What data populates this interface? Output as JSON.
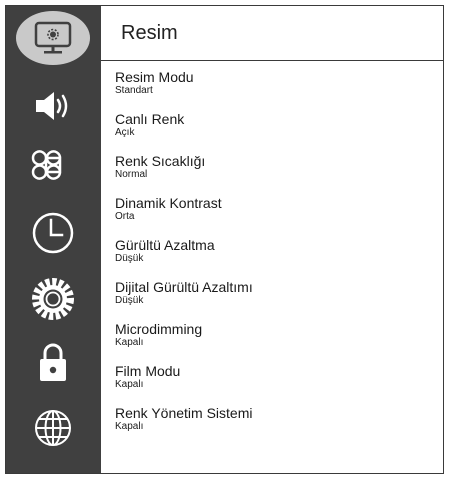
{
  "menu": {
    "title": "Resim",
    "items": [
      {
        "label": "Resim Modu",
        "value": "Standart"
      },
      {
        "label": "Canlı Renk",
        "value": "Açık"
      },
      {
        "label": "Renk Sıcaklığı",
        "value": "Normal"
      },
      {
        "label": "Dinamik Kontrast",
        "value": "Orta"
      },
      {
        "label": "Gürültü Azaltma",
        "value": "Düşük"
      },
      {
        "label": "Dijital Gürültü Azaltımı",
        "value": "Düşük"
      },
      {
        "label": "Microdimming",
        "value": "Kapalı"
      },
      {
        "label": "Film Modu",
        "value": "Kapalı"
      },
      {
        "label": "Renk Yönetim Sistemi",
        "value": "Kapalı"
      }
    ]
  },
  "sidebar": {
    "icons": [
      "picture-icon",
      "sound-icon",
      "source-icon",
      "timer-icon",
      "settings-icon",
      "lock-icon",
      "network-icon"
    ],
    "active": "picture-icon"
  },
  "colors": {
    "sidebar_bg": "#404040",
    "active_highlight": "#c9c9c9",
    "text": "#1a1a1a"
  }
}
